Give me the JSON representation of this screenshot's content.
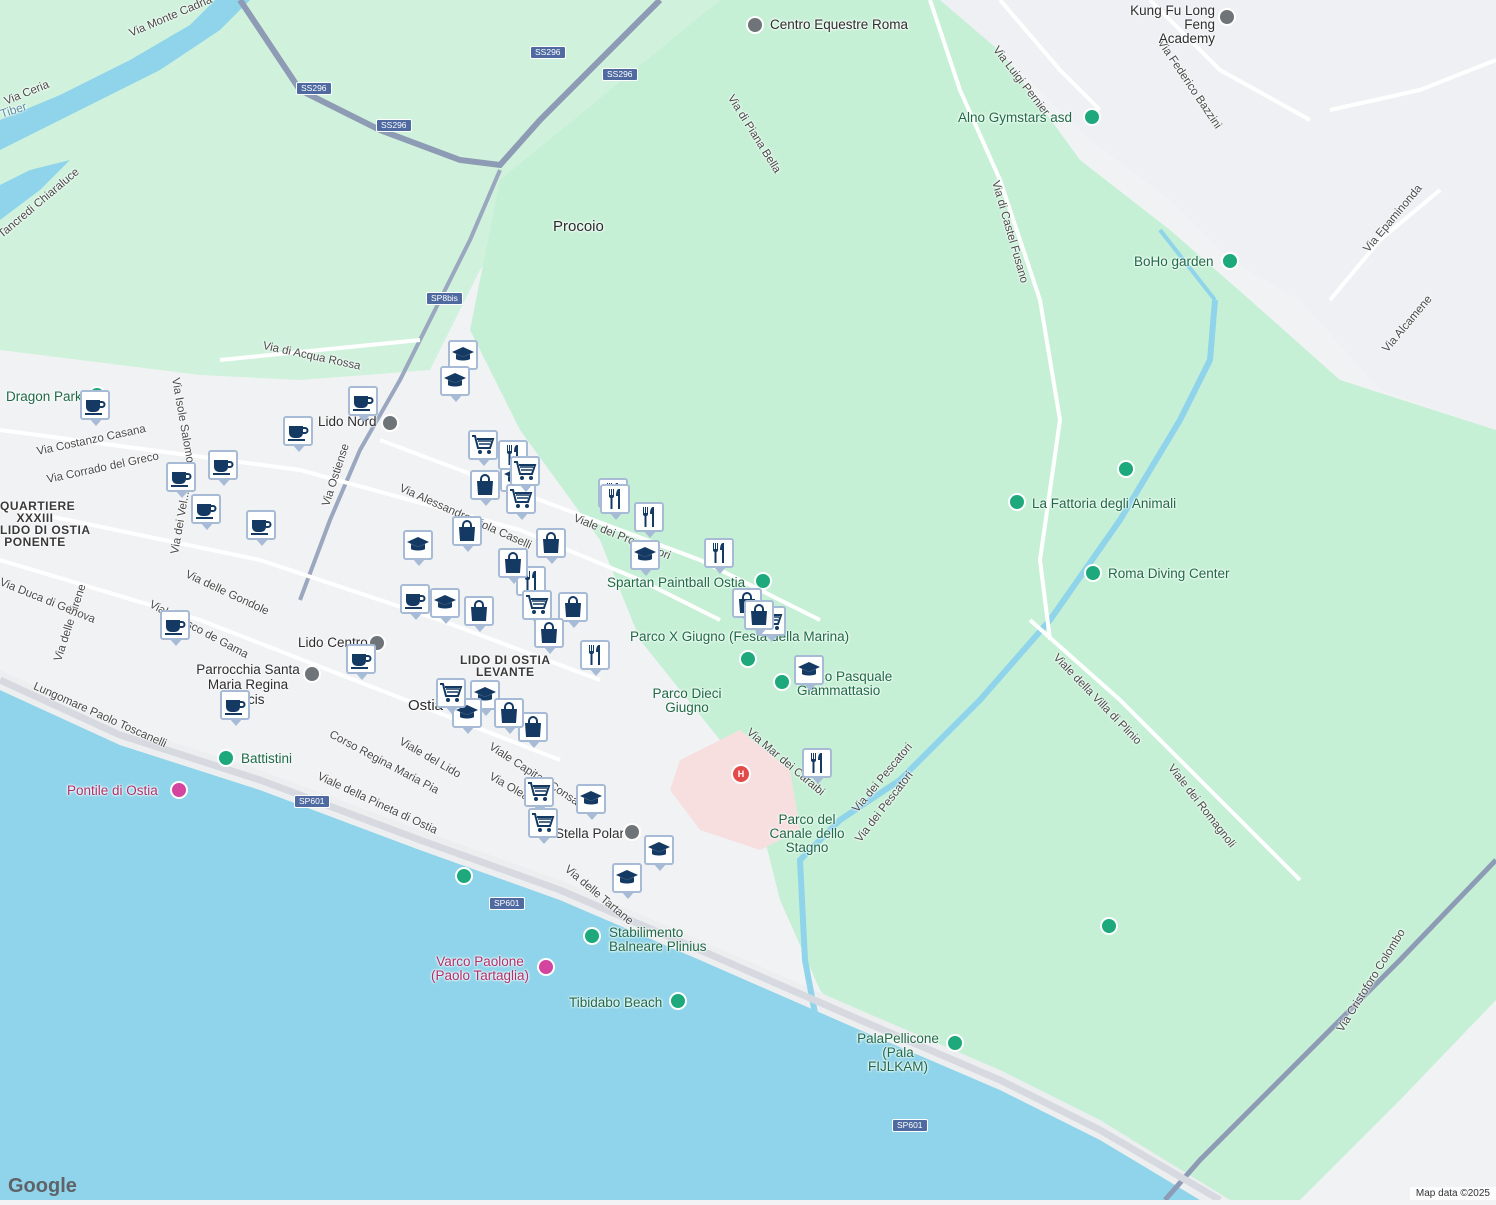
{
  "map": {
    "area_labels": {
      "procoio": "Procoio",
      "lido_levante": [
        "LIDO DI OSTIA",
        "LEVANTE"
      ],
      "quartiere": [
        "QUARTIERE",
        "XXXIII",
        "LIDO DI OSTIA",
        "PONENTE"
      ],
      "ostia": "Ostia",
      "river_label": "Tiber"
    },
    "roads": [
      {
        "id": "r1",
        "text": "Via Monte Cadria"
      },
      {
        "id": "r2",
        "text": "Via Ceria"
      },
      {
        "id": "r3",
        "text": "Tancredi Chiaraluce"
      },
      {
        "id": "r4",
        "text": "Via di Acqua Rossa"
      },
      {
        "id": "r5",
        "text": "Via Isole Salomone"
      },
      {
        "id": "r6",
        "text": "Via Costanzo Casana"
      },
      {
        "id": "r7",
        "text": "Via Corrado del Greco"
      },
      {
        "id": "r8",
        "text": "Via Ostiense"
      },
      {
        "id": "r9",
        "text": "Via Alessandro Piola Caselli"
      },
      {
        "id": "r10",
        "text": "Viale dei Promontori"
      },
      {
        "id": "r11",
        "text": "Via delle Gondole"
      },
      {
        "id": "r12",
        "text": "Via delle Sirene"
      },
      {
        "id": "r13",
        "text": "Via Duca di Genova"
      },
      {
        "id": "r14",
        "text": "Viale Vasco de Gama"
      },
      {
        "id": "r15",
        "text": "Lungomare Paolo Toscanelli"
      },
      {
        "id": "r16",
        "text": "Corso Regina Maria Pia"
      },
      {
        "id": "r17",
        "text": "Viale del Lido"
      },
      {
        "id": "r18",
        "text": "Viale della Pineta di Ostia"
      },
      {
        "id": "r19",
        "text": "Viale Capitan Consalvo"
      },
      {
        "id": "r20",
        "text": "Via delle Tartane"
      },
      {
        "id": "r21",
        "text": "Via Mar dei Caraibi"
      },
      {
        "id": "r22",
        "text": "Via dei Pescatori"
      },
      {
        "id": "r23",
        "text": "Via di Piana Bella"
      },
      {
        "id": "r24",
        "text": "Via di Castel Fusano"
      },
      {
        "id": "r25",
        "text": "Via Luigi Pernier"
      },
      {
        "id": "r26",
        "text": "Via Federico Bazzini"
      },
      {
        "id": "r27",
        "text": "Via Epaminonda"
      },
      {
        "id": "r28",
        "text": "Via Alcamene"
      },
      {
        "id": "r29",
        "text": "Viale della Villa di Plinio"
      },
      {
        "id": "r30",
        "text": "Via Cristoforo Colombo"
      },
      {
        "id": "r31",
        "text": "Via dei Vel..."
      },
      {
        "id": "r32",
        "text": "Via dei Pescatori"
      },
      {
        "id": "r33",
        "text": "Viale dei Romagnoli"
      },
      {
        "id": "r34",
        "text": "Via Olearia"
      }
    ],
    "shields": [
      {
        "id": "s1",
        "text": "SS296"
      },
      {
        "id": "s2",
        "text": "SS296"
      },
      {
        "id": "s3",
        "text": "SS296"
      },
      {
        "id": "s4",
        "text": "SS296"
      },
      {
        "id": "s5",
        "text": "SP8bis"
      },
      {
        "id": "s6",
        "text": "SP601"
      },
      {
        "id": "s7",
        "text": "SP601"
      },
      {
        "id": "s8",
        "text": "SP601"
      }
    ],
    "places": [
      {
        "id": "p1",
        "text": "Centro Equestre Roma",
        "color": "#6f7478"
      },
      {
        "id": "p2",
        "text": "Kung Fu Long Feng Academy",
        "color": "#6f7478"
      },
      {
        "id": "p3",
        "text": "Alno Gymstars asd",
        "color": "#1ea97c"
      },
      {
        "id": "p4",
        "text": "BoHo garden",
        "color": "#1ea97c"
      },
      {
        "id": "p5",
        "text": "La Fattoria degli Animali",
        "color": "#1ea97c"
      },
      {
        "id": "p6",
        "text": "Roma Diving Center",
        "color": "#1ea97c"
      },
      {
        "id": "p7",
        "text": "Spartan Paintball Ostia",
        "color": "#1ea97c"
      },
      {
        "id": "p8",
        "text": "Parco X Giugno (Festa della Marina)",
        "color": "#1ea97c"
      },
      {
        "id": "p9",
        "text": "Parco Dieci Giugno",
        "color": "#1ea97c"
      },
      {
        "id": "p10",
        "text": "Parco Pasquale Giammattasio",
        "color": "#1ea97c"
      },
      {
        "id": "p11",
        "text": "Parco del Canale dello Stagno",
        "color": "#1ea97c"
      },
      {
        "id": "p12",
        "text": "Dragon Park",
        "color": "#1ea97c"
      },
      {
        "id": "p13",
        "text": "Lido Nord",
        "color": "#6f7478"
      },
      {
        "id": "p14",
        "text": "Lido Centro",
        "color": "#6f7478"
      },
      {
        "id": "p15",
        "text": "Parrocchia Santa Maria Regina Pacis",
        "color": "#6f7478"
      },
      {
        "id": "p16",
        "text": "Battistini",
        "color": "#1ea97c"
      },
      {
        "id": "p17",
        "text": "Pontile di Ostia",
        "color": "#d3459e"
      },
      {
        "id": "p18",
        "text": "Stella Polare",
        "color": "#6f7478"
      },
      {
        "id": "p19",
        "text": "Stabilimento Balneare Plinius",
        "color": "#1ea97c"
      },
      {
        "id": "p20",
        "text": "Varco Paolone (Paolo Tartaglia)",
        "color": "#d3459e"
      },
      {
        "id": "p21",
        "text": "Tibidabo Beach",
        "color": "#1ea97c"
      },
      {
        "id": "p22",
        "text": "PalaPellicone (Pala FIJLKAM)",
        "color": "#1ea97c"
      },
      {
        "id": "p23",
        "text": "Ostia",
        "color": "#6f7478"
      }
    ],
    "markers": [
      {
        "type": "cafe-icon"
      },
      {
        "type": "cafe-icon"
      },
      {
        "type": "cafe-icon"
      },
      {
        "type": "cafe-icon"
      },
      {
        "type": "cafe-icon"
      },
      {
        "type": "cafe-icon"
      },
      {
        "type": "cafe-icon"
      },
      {
        "type": "cafe-icon"
      },
      {
        "type": "cafe-icon"
      },
      {
        "type": "cafe-icon"
      },
      {
        "type": "cafe-icon"
      },
      {
        "type": "school-icon"
      },
      {
        "type": "school-icon"
      },
      {
        "type": "school-icon"
      },
      {
        "type": "school-icon"
      },
      {
        "type": "school-icon"
      },
      {
        "type": "school-icon"
      },
      {
        "type": "school-icon"
      },
      {
        "type": "school-icon"
      },
      {
        "type": "school-icon"
      },
      {
        "type": "school-icon"
      },
      {
        "type": "school-icon"
      },
      {
        "type": "school-icon"
      },
      {
        "type": "restaurant-icon"
      },
      {
        "type": "restaurant-icon"
      },
      {
        "type": "restaurant-icon"
      },
      {
        "type": "restaurant-icon"
      },
      {
        "type": "restaurant-icon"
      },
      {
        "type": "restaurant-icon"
      },
      {
        "type": "restaurant-icon"
      },
      {
        "type": "restaurant-icon"
      },
      {
        "type": "grocery-cart-icon"
      },
      {
        "type": "grocery-cart-icon"
      },
      {
        "type": "grocery-cart-icon"
      },
      {
        "type": "grocery-cart-icon"
      },
      {
        "type": "grocery-cart-icon"
      },
      {
        "type": "grocery-cart-icon"
      },
      {
        "type": "grocery-cart-icon"
      },
      {
        "type": "grocery-cart-icon"
      },
      {
        "type": "shopping-bag-icon"
      },
      {
        "type": "shopping-bag-icon"
      },
      {
        "type": "shopping-bag-icon"
      },
      {
        "type": "shopping-bag-icon"
      },
      {
        "type": "shopping-bag-icon"
      },
      {
        "type": "shopping-bag-icon"
      },
      {
        "type": "shopping-bag-icon"
      },
      {
        "type": "shopping-bag-icon"
      },
      {
        "type": "shopping-bag-icon"
      },
      {
        "type": "shopping-bag-icon"
      },
      {
        "type": "shopping-bag-icon"
      }
    ],
    "colors": {
      "sea": "#8fd4ea",
      "park": "#c5efd6",
      "urban": "#f1f2f4",
      "road": "#ffffff",
      "highway": "#8d9bb5",
      "hospital": "#f7dfe0",
      "marker_border": "#a7bbd6",
      "marker_icon": "#143a63"
    }
  },
  "footer": {
    "logo": "Google",
    "attribution": "Map data ©2025"
  }
}
